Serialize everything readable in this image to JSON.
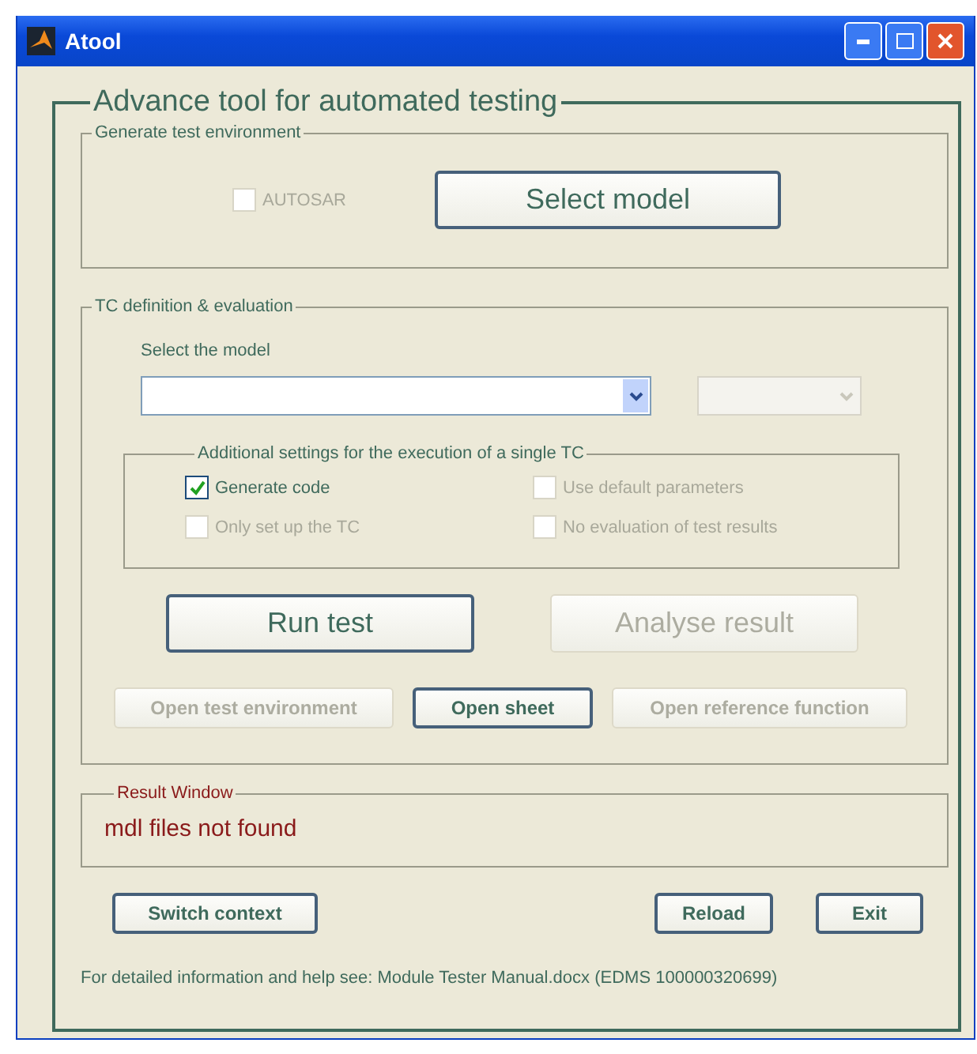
{
  "window": {
    "title": "Atool"
  },
  "main_group": {
    "title": "Advance tool for automated testing"
  },
  "generate_group": {
    "title": "Generate test environment",
    "autosar": {
      "label": "AUTOSAR",
      "checked": false,
      "disabled": true
    },
    "select_model_button": {
      "label": "Select model",
      "disabled": false
    }
  },
  "tc_group": {
    "title": "TC definition & evaluation",
    "model_label": "Select the model",
    "model_dropdown": {
      "disabled": false
    },
    "second_dropdown": {
      "disabled": true
    },
    "settings_group": {
      "title": "Additional  settings for the execution of a single TC",
      "options": [
        {
          "label": "Generate code",
          "checked": true,
          "disabled": false
        },
        {
          "label": "Use default parameters",
          "checked": false,
          "disabled": true
        },
        {
          "label": "Only set up the TC",
          "checked": false,
          "disabled": true
        },
        {
          "label": "No evaluation of test results",
          "checked": false,
          "disabled": true
        }
      ]
    },
    "main_buttons": [
      {
        "label": "Run test",
        "disabled": false
      },
      {
        "label": "Analyse result",
        "disabled": true
      }
    ],
    "small_buttons": [
      {
        "label": "Open test environment",
        "disabled": true
      },
      {
        "label": "Open sheet",
        "disabled": false
      },
      {
        "label": "Open reference function",
        "disabled": true
      }
    ]
  },
  "result_group": {
    "title": "Result Window",
    "message": "mdl files not found"
  },
  "bottom_buttons": [
    {
      "label": "Switch context",
      "disabled": false
    },
    {
      "label": "Reload",
      "disabled": false
    },
    {
      "label": "Exit",
      "disabled": false
    }
  ],
  "footer": "For detailed information and help see: Module Tester Manual.docx (EDMS 100000320699)"
}
